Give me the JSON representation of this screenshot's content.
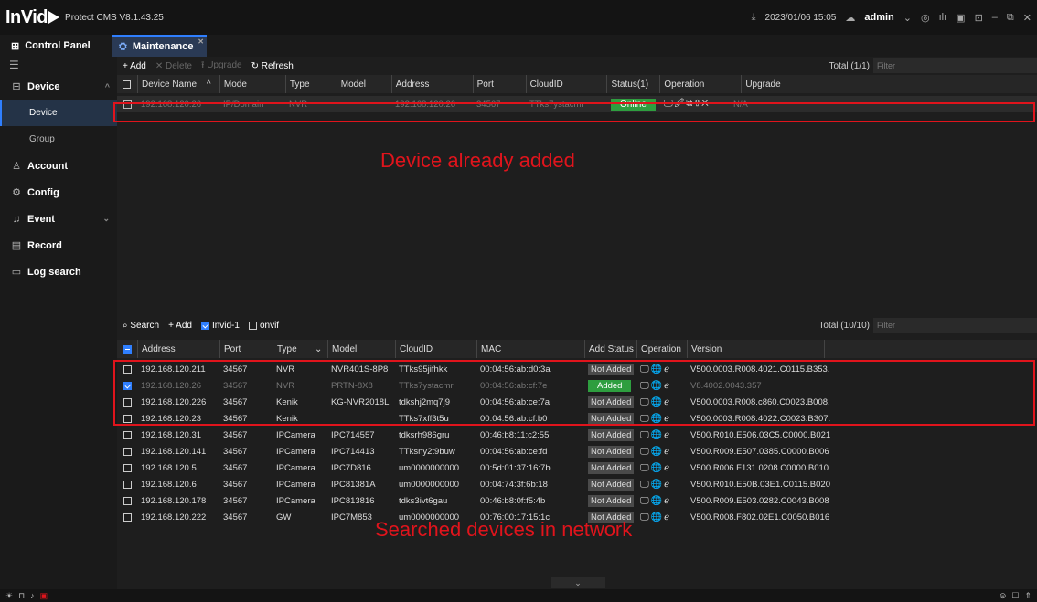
{
  "titlebar": {
    "logo": "InVid",
    "app_name": "Protect CMS V8.1.43.25",
    "datetime": "2023/01/06 15:05",
    "user": "admin"
  },
  "tabs": {
    "control_panel": "Control Panel",
    "maintenance": "Maintenance"
  },
  "sidebar": {
    "device": "Device",
    "device_sub": "Device",
    "group": "Group",
    "account": "Account",
    "config": "Config",
    "event": "Event",
    "record": "Record",
    "log_search": "Log search"
  },
  "top_toolbar": {
    "add": "+ Add",
    "delete": "✕ Delete",
    "upgrade": "⭱ Upgrade",
    "refresh": "↻ Refresh",
    "total": "Total (1/1)",
    "filter_placeholder": "Filter"
  },
  "top_table": {
    "headers": [
      "Device Name",
      "Mode",
      "Type",
      "Model",
      "Address",
      "Port",
      "CloudID",
      "Status(1)",
      "Operation",
      "Upgrade"
    ],
    "rows": [
      {
        "name": "192.168.120.26",
        "mode": "IP/Domain",
        "type": "NVR",
        "model": "",
        "address": "192.168.120.26",
        "port": "34567",
        "cloudid": "TTks7ystacmr",
        "status": "Online",
        "operation": "🖵🖉⧉⇧✕⋯",
        "upgrade": "N/A"
      }
    ]
  },
  "annotations": {
    "top": "Device already added",
    "bottom": "Searched devices in network"
  },
  "bottom_toolbar": {
    "search": "⌕ Search",
    "add": "+ Add",
    "invid": "Invid-1",
    "onvif": "onvif",
    "total": "Total (10/10)",
    "filter_placeholder": "Filter"
  },
  "bottom_table": {
    "headers": [
      "Address",
      "Port",
      "Type",
      "Model",
      "CloudID",
      "MAC",
      "Add Status",
      "Operation",
      "Version"
    ],
    "rows": [
      {
        "address": "192.168.120.211",
        "port": "34567",
        "type": "NVR",
        "model": "NVR401S-8P8",
        "cloudid": "TTks95jifhkk",
        "mac": "00:04:56:ab:d0:3a",
        "status": "Not Added",
        "version": "V500.0003.R008.4021.C0115.B353."
      },
      {
        "address": "192.168.120.26",
        "port": "34567",
        "type": "NVR",
        "model": "PRTN-8X8",
        "cloudid": "TTks7ystacmr",
        "mac": "00:04:56:ab:cf:7e",
        "status": "Added",
        "version": "V8.4002.0043.357"
      },
      {
        "address": "192.168.120.226",
        "port": "34567",
        "type": "Kenik",
        "model": "KG-NVR2018L",
        "cloudid": "tdkshj2mq7j9",
        "mac": "00:04:56:ab:ce:7a",
        "status": "Not Added",
        "version": "V500.0003.R008.c860.C0023.B008."
      },
      {
        "address": "192.168.120.23",
        "port": "34567",
        "type": "Kenik",
        "model": "",
        "cloudid": "TTks7xff3t5u",
        "mac": "00:04:56:ab:cf:b0",
        "status": "Not Added",
        "version": "V500.0003.R008.4022.C0023.B307."
      },
      {
        "address": "192.168.120.31",
        "port": "34567",
        "type": "IPCamera",
        "model": "IPC714557",
        "cloudid": "tdksrh986gru",
        "mac": "00:46:b8:11:c2:55",
        "status": "Not Added",
        "version": "V500.R010.E506.03C5.C0000.B021"
      },
      {
        "address": "192.168.120.141",
        "port": "34567",
        "type": "IPCamera",
        "model": "IPC714413",
        "cloudid": "TTksny2t9buw",
        "mac": "00:04:56:ab:ce:fd",
        "status": "Not Added",
        "version": "V500.R009.E507.0385.C0000.B006"
      },
      {
        "address": "192.168.120.5",
        "port": "34567",
        "type": "IPCamera",
        "model": "IPC7D816",
        "cloudid": "um0000000000",
        "mac": "00:5d:01:37:16:7b",
        "status": "Not Added",
        "version": "V500.R006.F131.0208.C0000.B010"
      },
      {
        "address": "192.168.120.6",
        "port": "34567",
        "type": "IPCamera",
        "model": "IPC81381A",
        "cloudid": "um0000000000",
        "mac": "00:04:74:3f:6b:18",
        "status": "Not Added",
        "version": "V500.R010.E50B.03E1.C0115.B020"
      },
      {
        "address": "192.168.120.178",
        "port": "34567",
        "type": "IPCamera",
        "model": "IPC813816",
        "cloudid": "tdks3ivt6gau",
        "mac": "00:46:b8:0f:f5:4b",
        "status": "Not Added",
        "version": "V500.R009.E503.0282.C0043.B008"
      },
      {
        "address": "192.168.120.222",
        "port": "34567",
        "type": "GW",
        "model": "IPC7M853",
        "cloudid": "um0000000000",
        "mac": "00:76:00:17:15:1c",
        "status": "Not Added",
        "version": "V500.R008.F802.02E1.C0050.B016"
      }
    ],
    "row_ops": "🖵🌐ℯ"
  },
  "colors": {
    "accent": "#2f7fff",
    "online": "#2e9e3f",
    "annotation": "#e0141c"
  }
}
